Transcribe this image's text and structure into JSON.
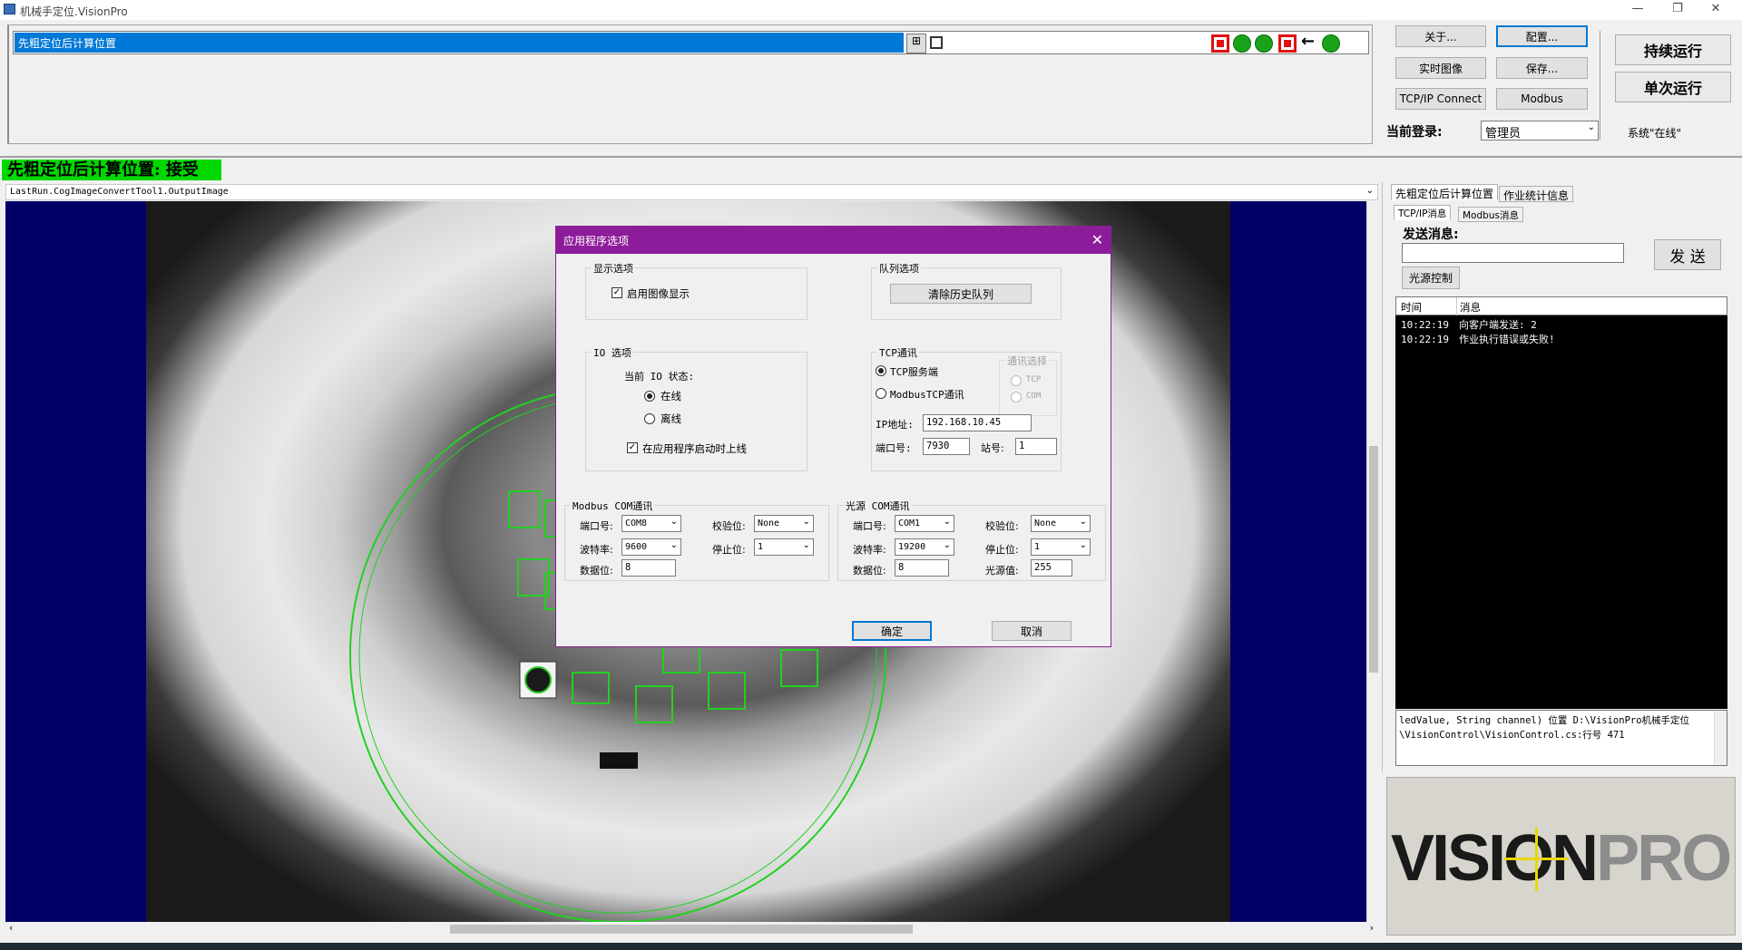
{
  "window": {
    "title": "机械手定位.VisionPro"
  },
  "job": {
    "name": "先粗定位后计算位置"
  },
  "buttons": {
    "about": "关于...",
    "config": "配置...",
    "live_image": "实时图像",
    "save": "保存...",
    "tcp_connect": "TCP/IP Connect",
    "modbus": "Modbus",
    "continuous_run": "持续运行",
    "single_run": "单次运行"
  },
  "login": {
    "label": "当前登录:",
    "user": "管理员",
    "system_status": "系统\"在线\""
  },
  "result_banner": "先粗定位后计算位置: 接受",
  "image_title": "LastRun.CogImageConvertTool1.OutputImage",
  "right_panel": {
    "tabs": [
      "先粗定位后计算位置",
      "作业统计信息"
    ],
    "subtabs": [
      "TCP/IP消息",
      "Modbus消息"
    ],
    "send_label": "发送消息:",
    "send_value": "",
    "send_button": "发 送",
    "light_control_button": "光源控制",
    "table_headers": [
      "时间",
      "消息"
    ],
    "messages": [
      {
        "time": "10:22:19",
        "text": "向客户端发送: 2"
      },
      {
        "time": "10:22:19",
        "text": "作业执行错误或失败!"
      }
    ],
    "log_lines": [
      "ledValue, String channel) 位置 D:\\VisionPro机械手定位",
      "\\VisionControl\\VisionControl.cs:行号 471"
    ],
    "logo_text": [
      "VISION",
      "PRO"
    ]
  },
  "dialog": {
    "title": "应用程序选项",
    "display_group": {
      "legend": "显示选项",
      "enable_image_display": "启用图像显示",
      "checked": true
    },
    "queue_group": {
      "legend": "队列选项",
      "clear_history": "清除历史队列"
    },
    "io_group": {
      "legend": "IO 选项",
      "current_state_label": "当前 IO 状态:",
      "online": "在线",
      "offline": "离线",
      "selected": "在线",
      "online_on_start": "在应用程序启动时上线",
      "online_on_start_checked": true
    },
    "tcp_group": {
      "legend": "TCP通讯",
      "tcp_server": "TCP服务端",
      "modbus_tcp": "ModbusTCP通讯",
      "selected": "TCP服务端",
      "comm_select_legend": "通讯选择",
      "comm_tcp": "TCP",
      "comm_com": "COM",
      "ip_label": "IP地址:",
      "ip_value": "192.168.10.45",
      "port_label": "端口号:",
      "port_value": "7930",
      "station_label": "站号:",
      "station_value": "1"
    },
    "modbus_com": {
      "legend": "Modbus COM通讯",
      "port_label": "端口号:",
      "port_value": "COM8",
      "parity_label": "校验位:",
      "parity_value": "None",
      "baud_label": "波特率:",
      "baud_value": "9600",
      "stopbits_label": "停止位:",
      "stopbits_value": "1",
      "databits_label": "数据位:",
      "databits_value": "8"
    },
    "light_com": {
      "legend": "光源 COM通讯",
      "port_label": "端口号:",
      "port_value": "COM1",
      "parity_label": "校验位:",
      "parity_value": "None",
      "baud_label": "波特率:",
      "baud_value": "19200",
      "stopbits_label": "停止位:",
      "stopbits_value": "1",
      "databits_label": "数据位:",
      "databits_value": "8",
      "light_value_label": "光源值:",
      "light_value": "255"
    },
    "ok": "确定",
    "cancel": "取消"
  }
}
